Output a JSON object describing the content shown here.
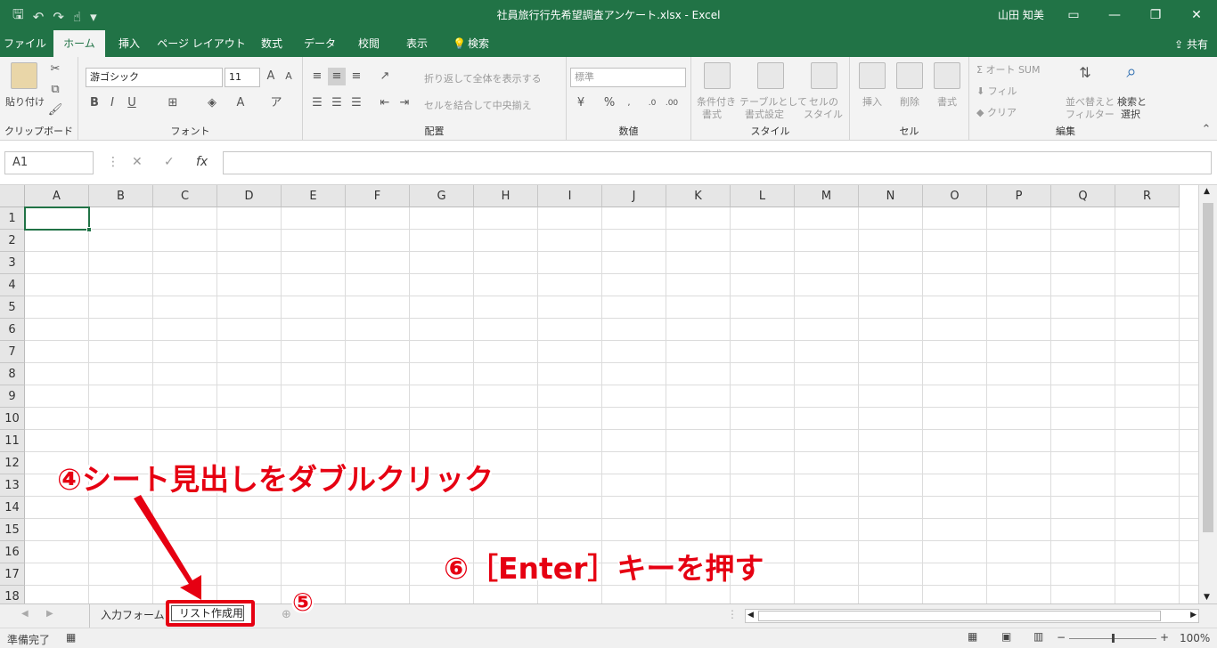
{
  "window": {
    "title": "社員旅行行先希望調査アンケート.xlsx  -  Excel",
    "user": "山田 知美"
  },
  "ribbon_tabs": [
    "ファイル",
    "ホーム",
    "挿入",
    "ページ レイアウト",
    "数式",
    "データ",
    "校閲",
    "表示",
    "検索"
  ],
  "share_label": "共有",
  "clipboard": {
    "paste": "貼り付け",
    "label": "クリップボード"
  },
  "font": {
    "name": "游ゴシック",
    "size": "11",
    "label": "フォント",
    "bold": "B",
    "italic": "I",
    "underline": "U"
  },
  "alignment": {
    "wrap": "折り返して全体を表示する",
    "merge": "セルを結合して中央揃え",
    "label": "配置"
  },
  "number": {
    "format": "標準",
    "label": "数値",
    "percent": "%"
  },
  "styles": {
    "conditional_1": "条件付き",
    "conditional_2": "書式",
    "table_1": "テーブルとして",
    "table_2": "書式設定",
    "cell_1": "セルの",
    "cell_2": "スタイル",
    "label": "スタイル"
  },
  "cells": {
    "insert": "挿入",
    "delete": "削除",
    "format": "書式",
    "label": "セル"
  },
  "editing": {
    "autosum": "オート SUM",
    "fill": "フィル",
    "clear": "クリア",
    "sort_1": "並べ替えと",
    "sort_2": "フィルター",
    "find_1": "検索と",
    "find_2": "選択",
    "label": "編集"
  },
  "formula_bar": {
    "name_box": "A1",
    "fx": "fx",
    "value": ""
  },
  "columns": [
    "A",
    "B",
    "C",
    "D",
    "E",
    "F",
    "G",
    "H",
    "I",
    "J",
    "K",
    "L",
    "M",
    "N",
    "O",
    "P",
    "Q",
    "R"
  ],
  "rows": [
    "1",
    "2",
    "3",
    "4",
    "5",
    "6",
    "7",
    "8",
    "9",
    "10",
    "11",
    "12",
    "13",
    "14",
    "15",
    "16",
    "17",
    "18"
  ],
  "sheets": [
    "入力フォーム",
    "リスト作成用"
  ],
  "status": {
    "ready": "準備完了",
    "zoom": "100%"
  },
  "annotations": {
    "step4": "④シート見出しをダブルクリック",
    "step5": "⑤",
    "step6": "⑥［Enter］キーを押す"
  },
  "colors": {
    "excel_green": "#217346",
    "annotation_red": "#e60012"
  }
}
